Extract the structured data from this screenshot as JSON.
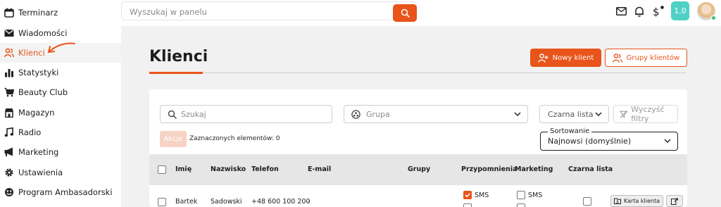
{
  "sidebar": {
    "items": [
      {
        "label": "Terminarz",
        "icon": "calendar-icon"
      },
      {
        "label": "Wiadomości",
        "icon": "envelope-icon"
      },
      {
        "label": "Klienci",
        "icon": "users-icon",
        "active": true
      },
      {
        "label": "Statystyki",
        "icon": "bar-chart-icon"
      },
      {
        "label": "Beauty Club",
        "icon": "cart-icon"
      },
      {
        "label": "Magazyn",
        "icon": "store-icon"
      },
      {
        "label": "Radio",
        "icon": "music-note-icon"
      },
      {
        "label": "Marketing",
        "icon": "megaphone-icon"
      },
      {
        "label": "Ustawienia",
        "icon": "gear-icon"
      },
      {
        "label": "Program Ambasadorski",
        "icon": "ambassador-icon"
      }
    ]
  },
  "topbar": {
    "search_placeholder": "Wyszukaj w panelu",
    "version": "1.0",
    "icons": [
      "envelope-icon",
      "bell-icon",
      "dollar-icon"
    ]
  },
  "main": {
    "title": "Klienci",
    "new_client_label": "Nowy klient",
    "client_groups_label": "Grupy klientów"
  },
  "filters": {
    "search_placeholder": "Szukaj",
    "group_placeholder": "Grupa",
    "blacklist_label": "Czarna lista",
    "clear_filters_label": "Wyczyść filtry",
    "actions_label": "Akcje",
    "selected_count": "Zaznaczonych elementów: 0",
    "sort_label": "Sortowanie",
    "sort_value": "Najnowsi (domyślnie)"
  },
  "table": {
    "headers": {
      "first_name": "Imię",
      "last_name": "Nazwisko",
      "phone": "Telefon",
      "email": "E-mail",
      "groups": "Grupy",
      "reminders": "Przypomnienia",
      "marketing": "Marketing",
      "blacklist": "Czarna lista"
    },
    "rows": [
      {
        "first_name": "Bartek",
        "last_name": "Sadowski",
        "phone": "+48 600 100 200",
        "email": "-",
        "reminders_sms": "SMS",
        "reminders_sms_checked": true,
        "marketing_sms": "SMS",
        "marketing_sms_checked": false,
        "client_card_label": "Karta klienta"
      }
    ]
  },
  "colors": {
    "accent": "#e8541a",
    "version_badge": "#4fd1c5"
  }
}
